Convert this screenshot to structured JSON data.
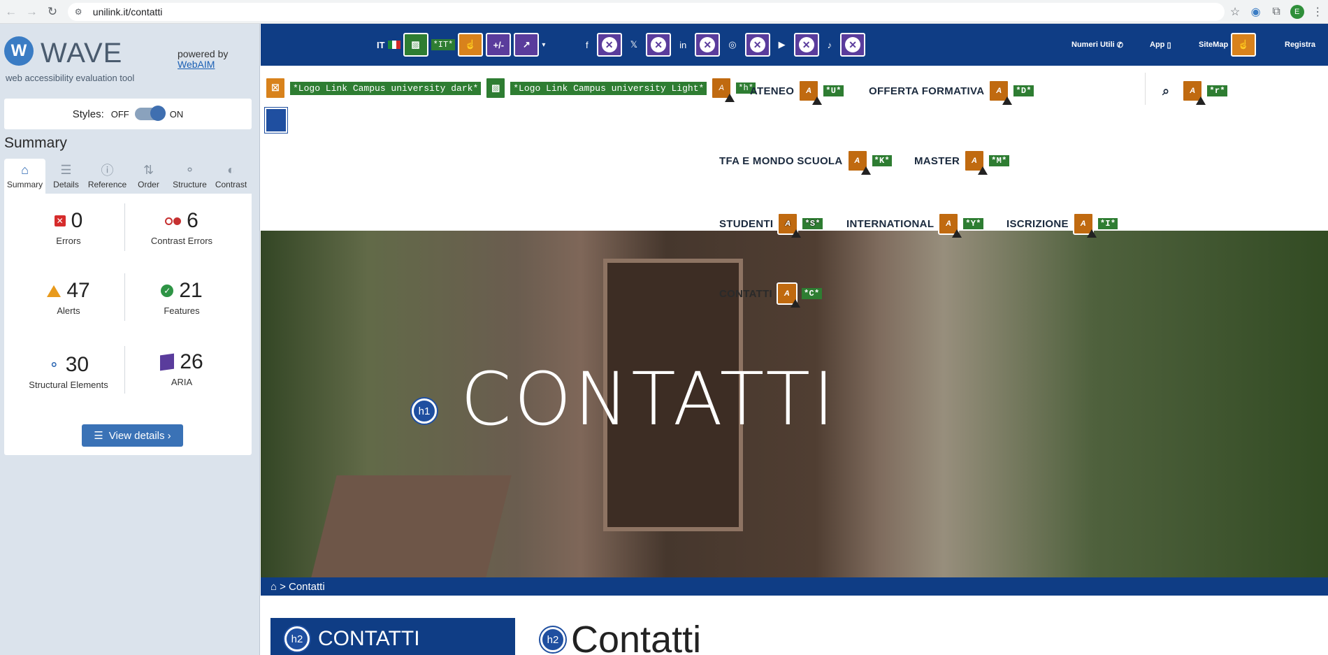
{
  "browser": {
    "url": "unilink.it/contatti",
    "profile_initial": "E"
  },
  "wave": {
    "title": "WAVE",
    "subtitle": "web accessibility evaluation tool",
    "powered_by": "powered by",
    "powered_link": "WebAIM",
    "styles_label": "Styles:",
    "off": "OFF",
    "on": "ON",
    "summary_heading": "Summary",
    "tabs": [
      {
        "label": "Summary"
      },
      {
        "label": "Details"
      },
      {
        "label": "Reference"
      },
      {
        "label": "Order"
      },
      {
        "label": "Structure"
      },
      {
        "label": "Contrast"
      }
    ],
    "stats": {
      "errors": {
        "value": "0",
        "label": "Errors"
      },
      "contrast": {
        "value": "6",
        "label": "Contrast Errors"
      },
      "alerts": {
        "value": "47",
        "label": "Alerts"
      },
      "features": {
        "value": "21",
        "label": "Features"
      },
      "structural": {
        "value": "30",
        "label": "Structural Elements"
      },
      "aria": {
        "value": "26",
        "label": "ARIA"
      }
    },
    "view_details": "View details ›"
  },
  "site": {
    "topbar": {
      "lang": "IT",
      "lang_tag": "*IT*",
      "numeri": "Numeri Utili",
      "app": "App",
      "sitemap": "SiteMap",
      "registra": "Registra"
    },
    "logo_dark": "*Logo Link Campus university dark*",
    "logo_light": "*Logo Link Campus university Light*",
    "tag_h": "*h*",
    "menu": [
      {
        "label": "ATENEO",
        "tag": "*U*"
      },
      {
        "label": "OFFERTA FORMATIVA",
        "tag": "*D*"
      },
      {
        "label": "TFA E MONDO SCUOLA",
        "tag": "*K*"
      },
      {
        "label": "MASTER",
        "tag": "*M*"
      },
      {
        "label": "STUDENTI",
        "tag": "*S*"
      },
      {
        "label": "INTERNATIONAL",
        "tag": "*Y*"
      },
      {
        "label": "ISCRIZIONE",
        "tag": "*I*"
      },
      {
        "label": "CONTATTI",
        "tag": "*C*"
      }
    ],
    "search_tag": "*r*",
    "hero_title": "CONTATTI",
    "h1_badge": "h1",
    "breadcrumb": "> Contatti",
    "h2_badge": "h2",
    "side_heading": "CONTATTI",
    "content_heading": "Contatti"
  }
}
